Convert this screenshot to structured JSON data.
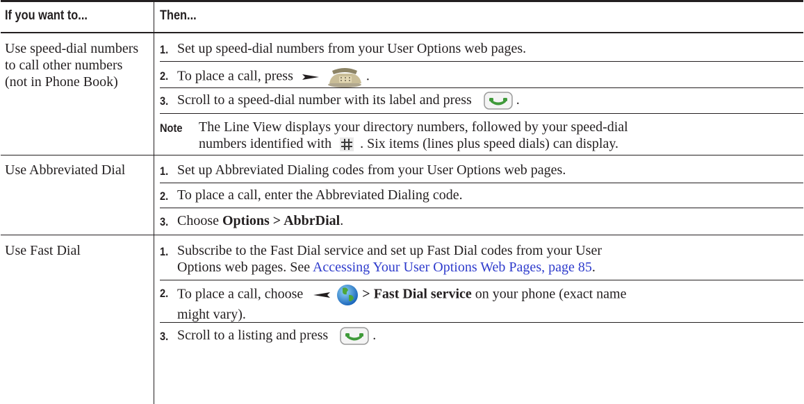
{
  "header": {
    "col1": "If you want to...",
    "col2": "Then..."
  },
  "rows": [
    {
      "label": "Use speed-dial numbers to call other numbers (not in Phone Book)",
      "steps": [
        {
          "num": "1.",
          "text": "Set up speed-dial numbers from your User Options web pages."
        },
        {
          "num": "2.",
          "pre": "To place a call, press",
          "post": "."
        },
        {
          "num": "3.",
          "pre": "Scroll to a speed-dial number with its label and press",
          "post": "."
        }
      ],
      "note": {
        "label": "Note",
        "line1": "The Line View displays your directory numbers, followed by your speed-dial",
        "line2_pre": "numbers identified with",
        "line2_post": ". Six items (lines plus speed dials) can display."
      }
    },
    {
      "label": "Use Abbreviated Dial",
      "steps": [
        {
          "num": "1.",
          "text": "Set up Abbreviated Dialing codes from your User Options web pages."
        },
        {
          "num": "2.",
          "text": "To place a call, enter the Abbreviated Dialing code."
        },
        {
          "num": "3.",
          "pre": "Choose",
          "bold": "Options > AbbrDial",
          "post": "."
        }
      ]
    },
    {
      "label": "Use Fast Dial",
      "steps": [
        {
          "num": "1.",
          "line1": "Subscribe to the Fast Dial service and set up Fast Dial codes from your User",
          "line2_pre": "Options web pages. See",
          "link": "Accessing Your User Options Web Pages, page 85",
          "line2_post": "."
        },
        {
          "num": "2.",
          "pre": "To place a call, choose",
          "bold": "> Fast Dial service",
          "mid": "on your phone (exact name",
          "line2": "might vary)."
        },
        {
          "num": "3.",
          "pre": "Scroll to a listing and press",
          "post": "."
        }
      ]
    }
  ],
  "icons": {
    "navigate_right": "navigate-right-arrow-icon",
    "phone": "directory-phone-icon",
    "call": "answer-call-green-icon",
    "speed_dial_grid": "speed-dial-grid-icon",
    "navigate_left": "navigate-left-arrow-icon",
    "services_globe": "services-globe-icon"
  },
  "colors": {
    "rule": "#231f20",
    "link": "#2e3bcc"
  }
}
